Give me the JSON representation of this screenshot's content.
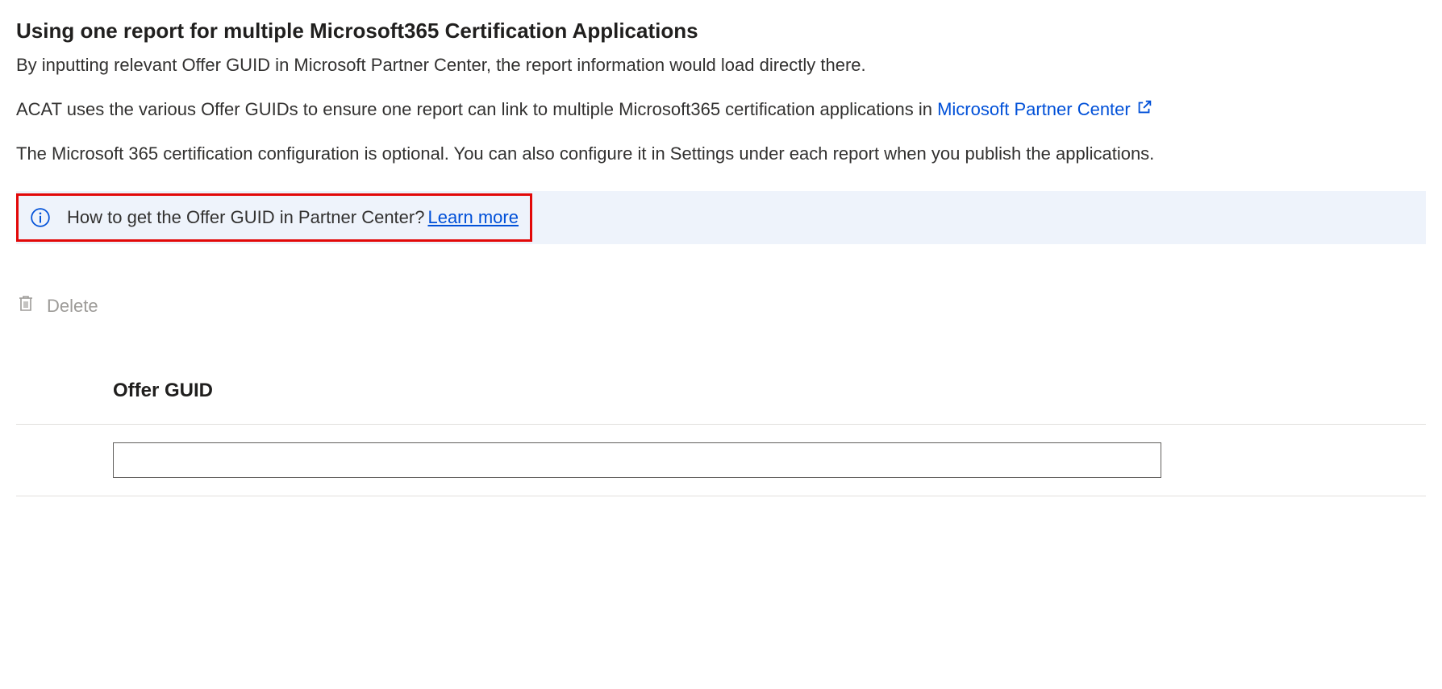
{
  "heading": "Using one report for multiple Microsoft365 Certification Applications",
  "intro": "By inputting relevant Offer GUID in Microsoft Partner Center, the report information would load directly there.",
  "para2_pre": "ACAT uses the various Offer GUIDs to ensure one report can link to multiple Microsoft365 certification applications in ",
  "para2_link": "Microsoft Partner Center",
  "para3": "The Microsoft 365 certification configuration is optional. You can also configure it in Settings under each report when you publish the applications.",
  "info_text": "How to get the Offer GUID in Partner Center? ",
  "learn_more": "Learn more",
  "delete_label": "Delete",
  "column_header": "Offer GUID",
  "input_value": ""
}
